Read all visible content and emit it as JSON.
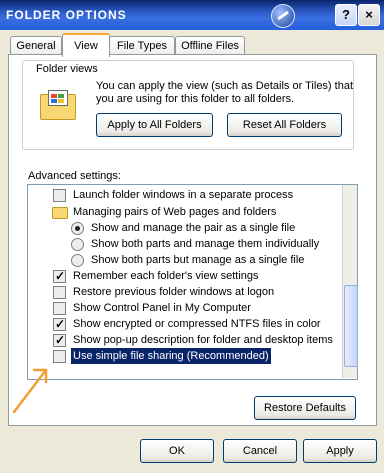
{
  "window": {
    "title": "Folder Options",
    "help_label": "?",
    "close_label": "×"
  },
  "tabs": [
    {
      "label": "General"
    },
    {
      "label": "View"
    },
    {
      "label": "File Types"
    },
    {
      "label": "Offline Files"
    }
  ],
  "folder_views": {
    "legend": "Folder views",
    "description": "You can apply the view (such as Details or Tiles) that you are using for this folder to all folders.",
    "apply_label": "Apply to All Folders",
    "reset_label": "Reset All Folders"
  },
  "advanced": {
    "label": "Advanced settings:",
    "items": [
      {
        "type": "checkbox",
        "checked": false,
        "label": "Launch folder windows in a separate process"
      },
      {
        "type": "folder",
        "label": "Managing pairs of Web pages and folders"
      },
      {
        "type": "radio",
        "checked": true,
        "label": "Show and manage the pair as a single file"
      },
      {
        "type": "radio",
        "checked": false,
        "label": "Show both parts and manage them individually"
      },
      {
        "type": "radio",
        "checked": false,
        "label": "Show both parts but manage as a single file"
      },
      {
        "type": "checkbox",
        "checked": true,
        "label": "Remember each folder's view settings"
      },
      {
        "type": "checkbox",
        "checked": false,
        "label": "Restore previous folder windows at logon"
      },
      {
        "type": "checkbox",
        "checked": false,
        "label": "Show Control Panel in My Computer"
      },
      {
        "type": "checkbox",
        "checked": true,
        "label": "Show encrypted or compressed NTFS files in color"
      },
      {
        "type": "checkbox",
        "checked": true,
        "label": "Show pop-up description for folder and desktop items"
      },
      {
        "type": "checkbox",
        "checked": false,
        "selected": true,
        "label": "Use simple file sharing (Recommended)"
      }
    ]
  },
  "restore_defaults_label": "Restore Defaults",
  "footer": {
    "ok_label": "OK",
    "cancel_label": "Cancel",
    "apply_label": "Apply"
  },
  "colors": {
    "titlebar": "#245edb",
    "selection": "#0a246a",
    "annotation_arrow": "#f0a030"
  }
}
